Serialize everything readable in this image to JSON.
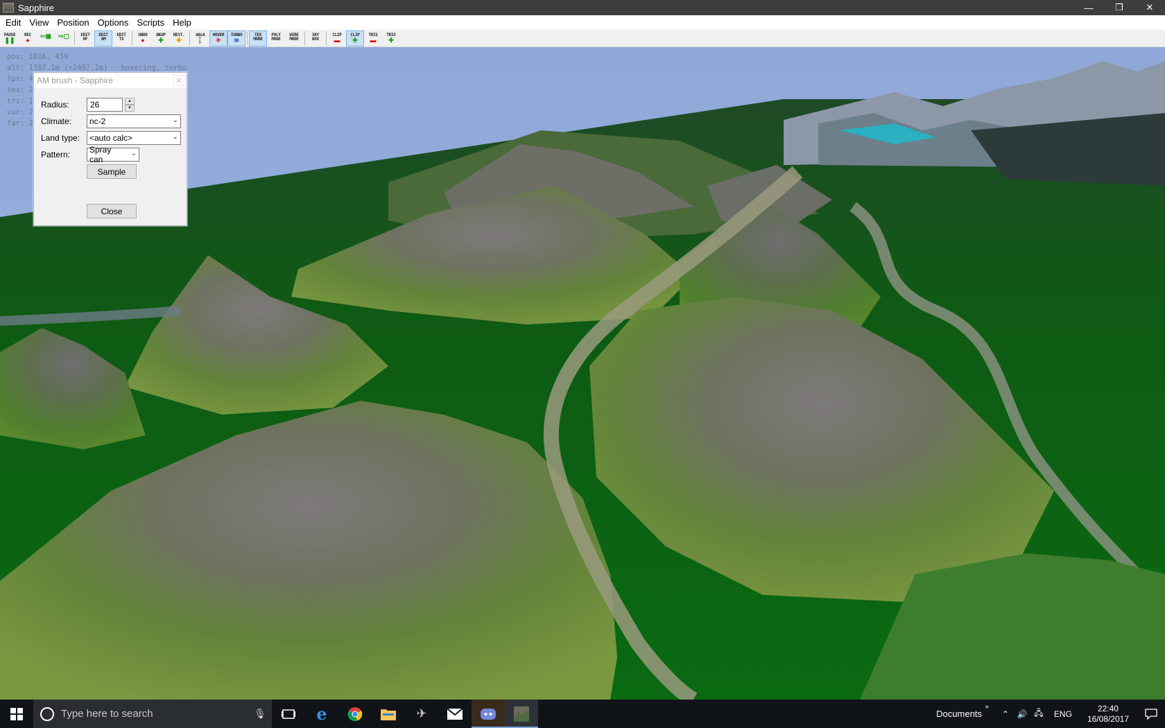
{
  "window": {
    "title": "Sapphire",
    "controls": {
      "minimize": "—",
      "restore": "❐",
      "close": "✕"
    }
  },
  "menu": [
    "Edit",
    "View",
    "Position",
    "Options",
    "Scripts",
    "Help"
  ],
  "toolbar": [
    {
      "label": "PAUSE",
      "glyph": "❚❚",
      "glyph_color": "green",
      "active": false
    },
    {
      "label": "REC",
      "glyph": "●",
      "glyph_color": "red",
      "active": false
    },
    {
      "label": "",
      "glyph": "⇦▣",
      "glyph_color": "green",
      "active": false
    },
    {
      "label": "",
      "glyph": "⇨▢",
      "glyph_color": "green",
      "active": false
    },
    {
      "sep": true
    },
    {
      "label": "EDIT\nHF",
      "glyph": "",
      "glyph_color": "black",
      "active": false
    },
    {
      "label": "EDIT\nAM",
      "glyph": "",
      "glyph_color": "black",
      "active": true
    },
    {
      "label": "EDIT\nTX",
      "glyph": "",
      "glyph_color": "black",
      "active": false
    },
    {
      "sep": true
    },
    {
      "label": "UNDO",
      "glyph": "●",
      "glyph_color": "red",
      "active": false
    },
    {
      "label": "BKUP",
      "glyph": "✚",
      "glyph_color": "green",
      "active": false
    },
    {
      "label": "REST.",
      "glyph": "✚",
      "glyph_color": "yellow",
      "active": false
    },
    {
      "sep": true
    },
    {
      "label": "WALK",
      "glyph": "🚶",
      "glyph_color": "black",
      "active": false
    },
    {
      "label": "HOVER",
      "glyph": "✈",
      "glyph_color": "red",
      "active": true
    },
    {
      "label": "TURBO",
      "glyph": "≋",
      "glyph_color": "blue",
      "active": true
    },
    {
      "sep": true
    },
    {
      "label": "TEX\nMODE",
      "glyph": "",
      "glyph_color": "black",
      "active": true
    },
    {
      "label": "POLY\nMODE",
      "glyph": "",
      "glyph_color": "black",
      "active": false
    },
    {
      "label": "WIRE\nMODE",
      "glyph": "",
      "glyph_color": "black",
      "active": false
    },
    {
      "sep": true
    },
    {
      "label": "SKY\nBOX",
      "glyph": "",
      "glyph_color": "black",
      "active": false
    },
    {
      "sep": true
    },
    {
      "label": "CLIP",
      "glyph": "▬",
      "glyph_color": "red",
      "active": false
    },
    {
      "label": "CLIP",
      "glyph": "✚",
      "glyph_color": "green",
      "active": true
    },
    {
      "label": "TRIS",
      "glyph": "▬",
      "glyph_color": "red",
      "active": false
    },
    {
      "label": "TRIS",
      "glyph": "✚",
      "glyph_color": "green",
      "active": false
    }
  ],
  "overlay": {
    "pos": "pos: 1016, 459",
    "alt": "alt: 1387.1m (+1497.1m) - hovering, turbo",
    "fps": "fps: 4",
    "tex": "tex: 2",
    "tri": "tri: 1",
    "var": "var: 2",
    "far": "far: 2"
  },
  "dialog": {
    "title": "AM brush - Sapphire",
    "close_glyph": "✕",
    "radius_label": "Radius:",
    "radius_value": "26",
    "climate_label": "Climate:",
    "climate_value": "nc-2",
    "landtype_label": "Land type:",
    "landtype_value": "<auto calc>",
    "pattern_label": "Pattern:",
    "pattern_value": "Spray can",
    "sample_button": "Sample",
    "close_button": "Close"
  },
  "taskbar": {
    "search_placeholder": "Type here to search",
    "apps": [
      {
        "name": "task-view",
        "glyph": "❐"
      },
      {
        "name": "edge",
        "glyph": "e"
      },
      {
        "name": "chrome",
        "glyph": "◉"
      },
      {
        "name": "file-explorer",
        "glyph": "📁"
      },
      {
        "name": "game",
        "glyph": "✈"
      },
      {
        "name": "mail",
        "glyph": "✉"
      },
      {
        "name": "discord",
        "glyph": "☺"
      },
      {
        "name": "sapphire",
        "glyph": "▣"
      }
    ],
    "tray_documents": "Documents",
    "tray_chevron": "»",
    "language": "ENG",
    "time": "22:40",
    "date": "16/08/2017"
  }
}
